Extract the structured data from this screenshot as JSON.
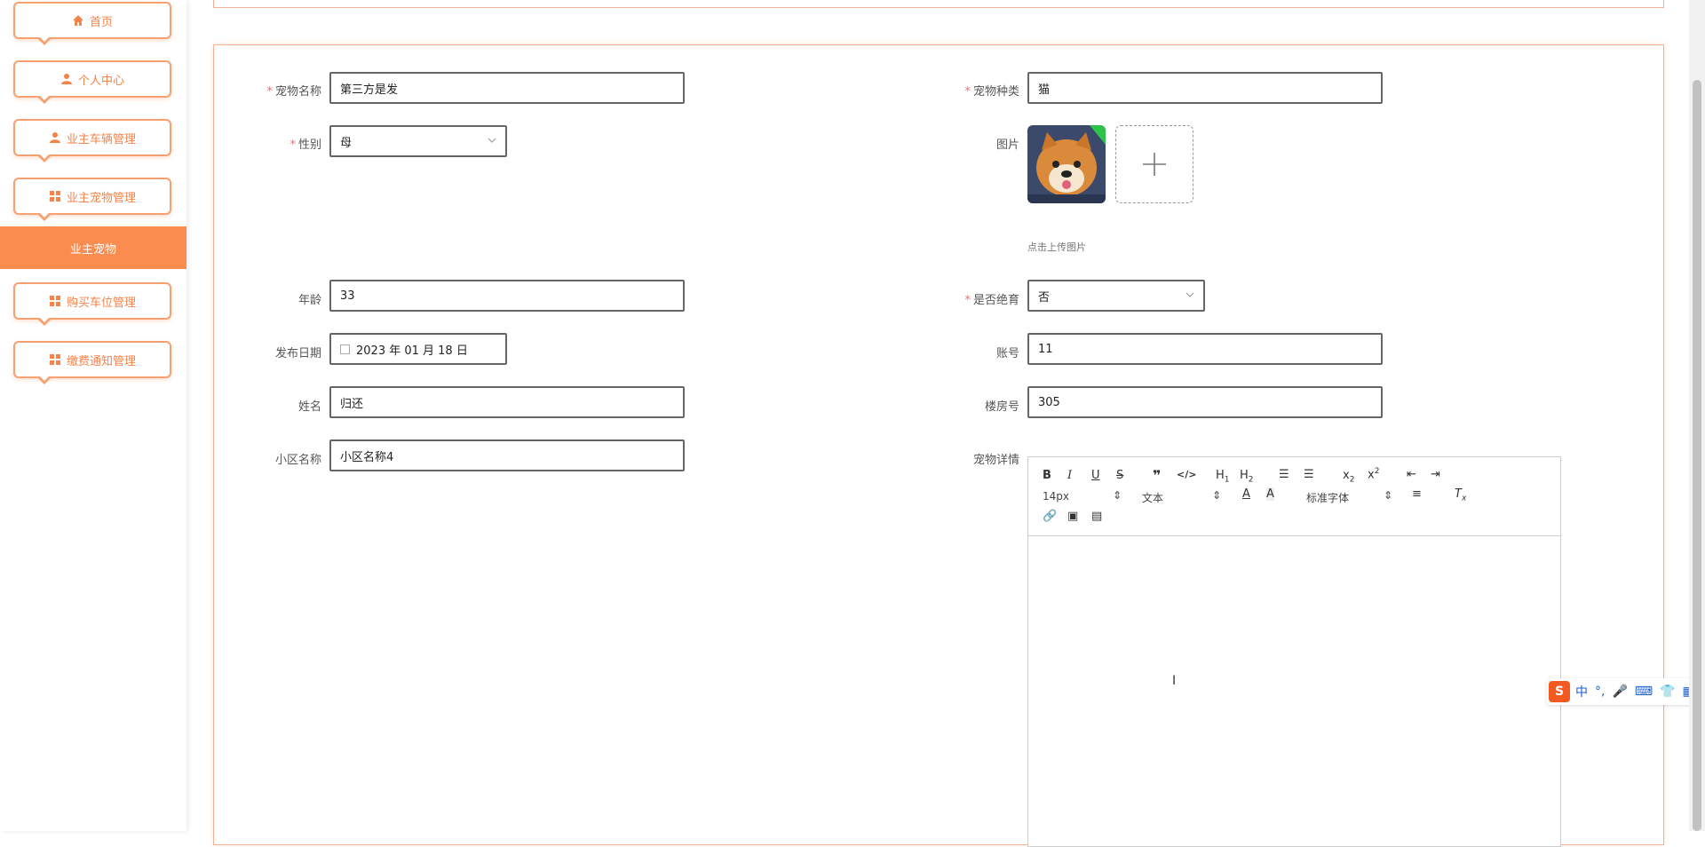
{
  "sidebar": {
    "items": [
      {
        "label": "首页",
        "icon": "home-icon"
      },
      {
        "label": "个人中心",
        "icon": "user-icon"
      },
      {
        "label": "业主车辆管理",
        "icon": "user-icon"
      },
      {
        "label": "业主宠物管理",
        "icon": "grid-icon"
      },
      {
        "label": "业主宠物",
        "active": true
      },
      {
        "label": "购买车位管理",
        "icon": "grid-icon"
      },
      {
        "label": "缴费通知管理",
        "icon": "grid-icon"
      }
    ]
  },
  "form": {
    "pet_name": {
      "label": "宠物名称",
      "value": "第三方是发",
      "required": true
    },
    "pet_type": {
      "label": "宠物种类",
      "value": "猫",
      "required": true
    },
    "gender": {
      "label": "性别",
      "value": "母",
      "required": true
    },
    "image": {
      "label": "图片",
      "hint": "点击上传图片"
    },
    "age": {
      "label": "年龄",
      "value": "33"
    },
    "neutered": {
      "label": "是否绝育",
      "value": "否",
      "required": true
    },
    "publish_date": {
      "label": "发布日期",
      "value": "2023 年 01 月 18 日"
    },
    "account": {
      "label": "账号",
      "value": "11"
    },
    "name": {
      "label": "姓名",
      "value": "归还"
    },
    "room": {
      "label": "楼房号",
      "value": "305"
    },
    "community": {
      "label": "小区名称",
      "value": "小区名称4"
    },
    "details": {
      "label": "宠物详情"
    }
  },
  "editor": {
    "font_size": "14px",
    "block_type": "文本",
    "font_family": "标准字体"
  },
  "ime": {
    "mode": "中"
  },
  "colors": {
    "accent": "#fb8c50",
    "border": "#f3b08c",
    "required": "#f56c6c"
  }
}
